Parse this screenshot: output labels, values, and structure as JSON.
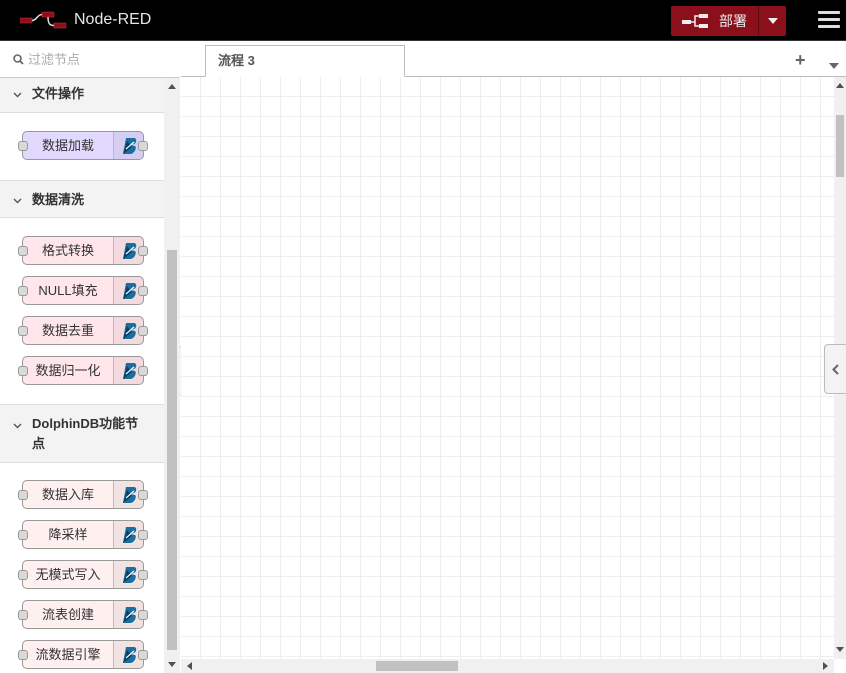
{
  "header": {
    "title": "Node-RED",
    "deploy_label": "部署"
  },
  "palette": {
    "filter_placeholder": "过滤节点",
    "categories": [
      {
        "label": "文件操作",
        "nodes": [
          {
            "label": "数据加载",
            "color": "#e2d9ff"
          }
        ]
      },
      {
        "label": "数据清洗",
        "nodes": [
          {
            "label": "格式转换",
            "color": "#ffe6ea"
          },
          {
            "label": "NULL填充",
            "color": "#ffe6ea"
          },
          {
            "label": "数据去重",
            "color": "#ffe6ea"
          },
          {
            "label": "数据归一化",
            "color": "#ffe6ea"
          }
        ]
      },
      {
        "label_line1": "DolphinDB功能节",
        "label_line2": "点",
        "nodes": [
          {
            "label": "数据入库",
            "color": "#fff0f0"
          },
          {
            "label": "降采样",
            "color": "#fff0f0"
          },
          {
            "label": "无模式写入",
            "color": "#fff0f0"
          },
          {
            "label": "流表创建",
            "color": "#fff0f0"
          },
          {
            "label": "流数据引擎",
            "color": "#fff0f0"
          }
        ]
      }
    ]
  },
  "workspace": {
    "tabs": [
      {
        "label": "流程 3"
      }
    ]
  },
  "icons": {
    "node_icon": "dolphindb-logo-icon",
    "accent": "#1a6fa0"
  }
}
